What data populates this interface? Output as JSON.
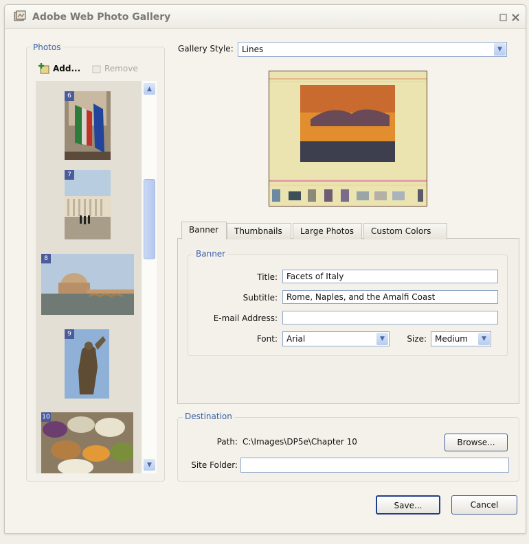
{
  "window": {
    "title": "Adobe Web Photo Gallery"
  },
  "photos": {
    "legend": "Photos",
    "add_label": "Add...",
    "remove_label": "Remove",
    "thumbs": [
      "6",
      "7",
      "8",
      "9",
      "10"
    ]
  },
  "gallery_style": {
    "label": "Gallery Style:",
    "value": "Lines"
  },
  "tabs": [
    "Banner",
    "Thumbnails",
    "Large Photos",
    "Custom Colors"
  ],
  "banner": {
    "legend": "Banner",
    "title_label": "Title:",
    "title_value": "Facets of Italy",
    "subtitle_label": "Subtitle:",
    "subtitle_value": "Rome, Naples, and the Amalfi Coast",
    "email_label": "E-mail Address:",
    "email_value": "",
    "font_label": "Font:",
    "font_value": "Arial",
    "size_label": "Size:",
    "size_value": "Medium"
  },
  "destination": {
    "legend": "Destination",
    "path_label": "Path:",
    "path_value": "C:\\Images\\DP5e\\Chapter 10",
    "browse_label": "Browse...",
    "site_folder_label": "Site Folder:",
    "site_folder_value": ""
  },
  "footer": {
    "save_label": "Save...",
    "cancel_label": "Cancel"
  },
  "colors": {
    "accent": "#3b5fa8",
    "button_border": "#1f3d8a"
  }
}
